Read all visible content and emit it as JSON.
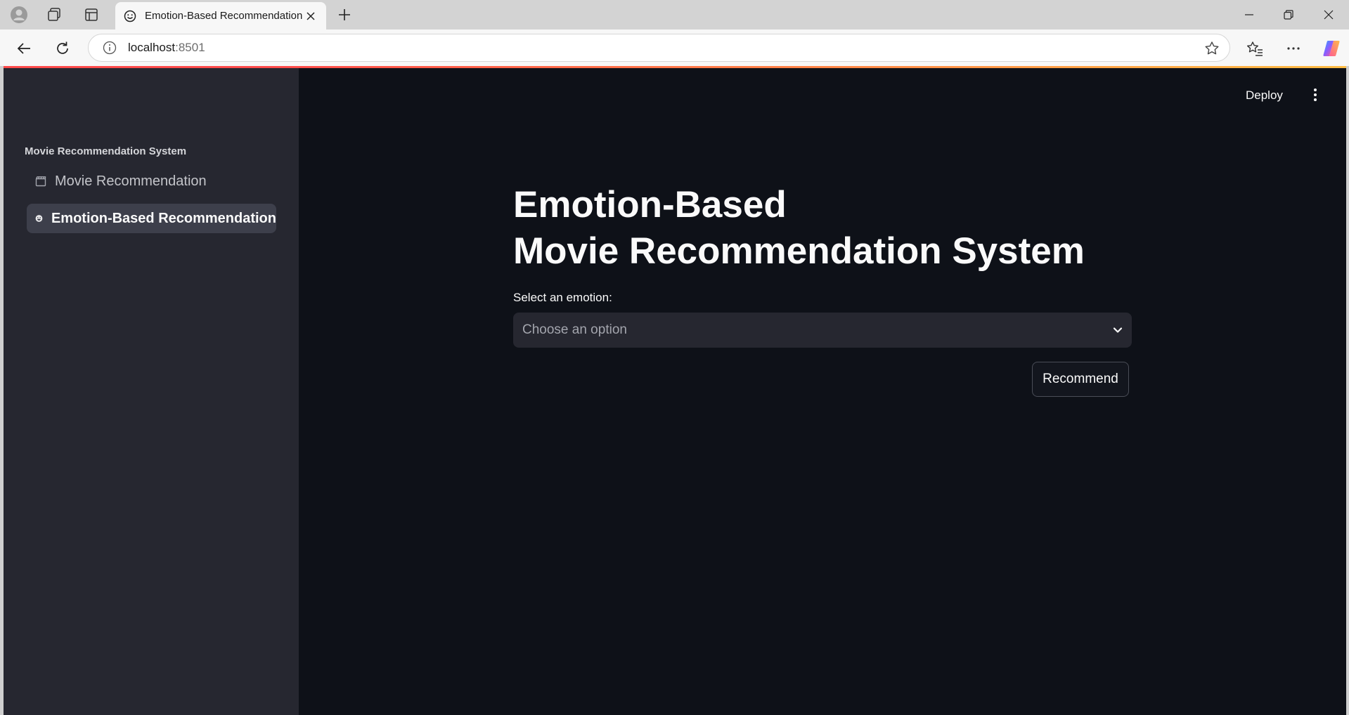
{
  "browser": {
    "tab_title": "Emotion-Based Recommendation",
    "address_host": "localhost",
    "address_port": ":8501"
  },
  "app": {
    "header": {
      "deploy_label": "Deploy"
    },
    "sidebar": {
      "heading": "Movie Recommendation System",
      "items": [
        {
          "label": "Movie Recommendation",
          "icon": "clapperboard-icon",
          "active": false
        },
        {
          "label": "Emotion-Based Recommendation",
          "icon": "smiley-icon",
          "active": true
        }
      ]
    },
    "main": {
      "title_line1": "Emotion-Based",
      "title_line2": "Movie Recommendation System",
      "select_label": "Select an emotion:",
      "select_placeholder": "Choose an option",
      "button_label": "Recommend"
    }
  },
  "colors": {
    "app_bg": "#0e1118",
    "sidebar_bg": "#262730",
    "accent": "#ff4b4b"
  }
}
